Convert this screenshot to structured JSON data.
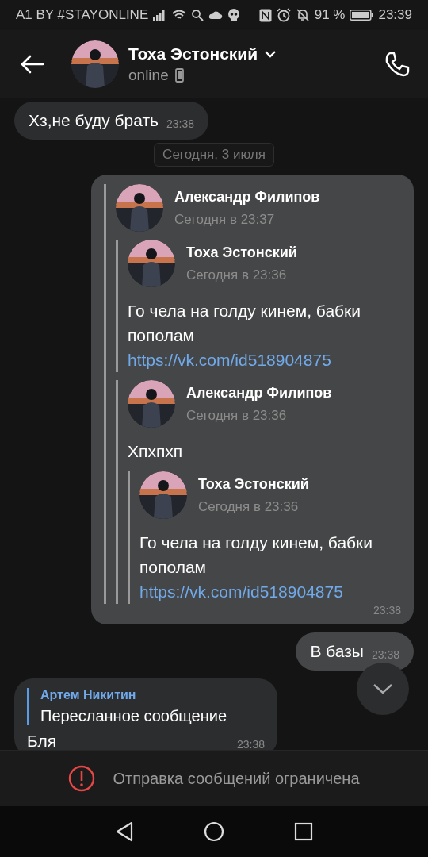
{
  "status_bar": {
    "carrier": "A1 BY #STAYONLINE",
    "battery_percent": "91 %",
    "time": "23:39"
  },
  "header": {
    "name": "Тоха Эстонский",
    "status": "online"
  },
  "messages": [
    {
      "kind": "incoming",
      "text": "Хз,не буду брать",
      "time": "23:38"
    },
    {
      "kind": "date",
      "text": "Сегодня, 3 июля"
    },
    {
      "kind": "forward",
      "time": "23:38",
      "forward": {
        "author": "Александр Филипов",
        "date": "Сегодня в 23:37",
        "children": [
          {
            "author": "Тоха Эстонский",
            "date": "Сегодня в 23:36",
            "text": "Го чела на голду кинем, бабки пополам",
            "link": "https://vk.com/id518904875"
          },
          {
            "author": "Александр Филипов",
            "date": "Сегодня в 23:36",
            "text": "Хпхпхп",
            "children": [
              {
                "author": "Тоха Эстонский",
                "date": "Сегодня в 23:36",
                "text": "Го чела на голду кинем, бабки пополам",
                "link": "https://vk.com/id518904875"
              }
            ]
          }
        ]
      }
    },
    {
      "kind": "outgoing",
      "text": "В базы",
      "time": "23:38"
    },
    {
      "kind": "reply",
      "reply_author": "Артем Никитин",
      "reply_text": "Пересланное сообщение",
      "text": "Бля",
      "time": "23:38"
    }
  ],
  "restriction": {
    "text": "Отправка сообщений ограничена"
  }
}
